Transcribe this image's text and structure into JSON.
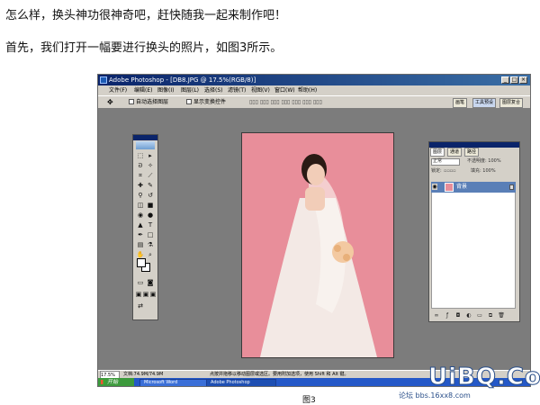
{
  "article": {
    "intro_line1": "怎么样，换头神功很神奇吧，赶快随我一起来制作吧！",
    "intro_line2": "首先，我们打开一幅要进行换头的照片，如图3所示。",
    "figure_caption": "图3"
  },
  "photoshop": {
    "title": "Adobe Photoshop - [DB8.JPG @ 17.5%(RGB/8)]",
    "window_buttons": [
      "_",
      "□",
      "×"
    ],
    "menu": [
      "文件(F)",
      "编辑(E)",
      "图像(I)",
      "图层(L)",
      "选择(S)",
      "滤镜(T)",
      "视图(V)",
      "窗口(W)",
      "帮助(H)"
    ],
    "options": {
      "auto_select_label": "自动选择图层",
      "show_bounds_label": "显示变换控件",
      "right_tabs": [
        "画笔",
        "工具预设",
        "图层复合"
      ]
    },
    "layers_panel": {
      "tabs": [
        "图层",
        "通道",
        "路径"
      ],
      "blend_mode": "正常",
      "opacity_label": "不透明度: 100%",
      "lock_label": "锁定:",
      "fill_label": "填充: 100%",
      "layer_name": "背景"
    },
    "status": {
      "zoom": "17.5%",
      "doc_size": "文档:74.9M/74.9M",
      "hint": "点按并拖移以移动图层或选区。要用附加选项，使用 Shift 和 Alt 键。"
    }
  },
  "taskbar": {
    "start_label": "开始",
    "tasks": [
      "Microsoft Word",
      "Adobe Photoshop"
    ]
  },
  "watermark": {
    "logo": "UiBQ.CoM",
    "url": "论坛 bbs.16xx8.com"
  },
  "colors": {
    "photo_background": "#e88e9a",
    "titlebar": "#0a246a",
    "workspace": "#7c7c7c",
    "taskbar": "#2458c8"
  }
}
